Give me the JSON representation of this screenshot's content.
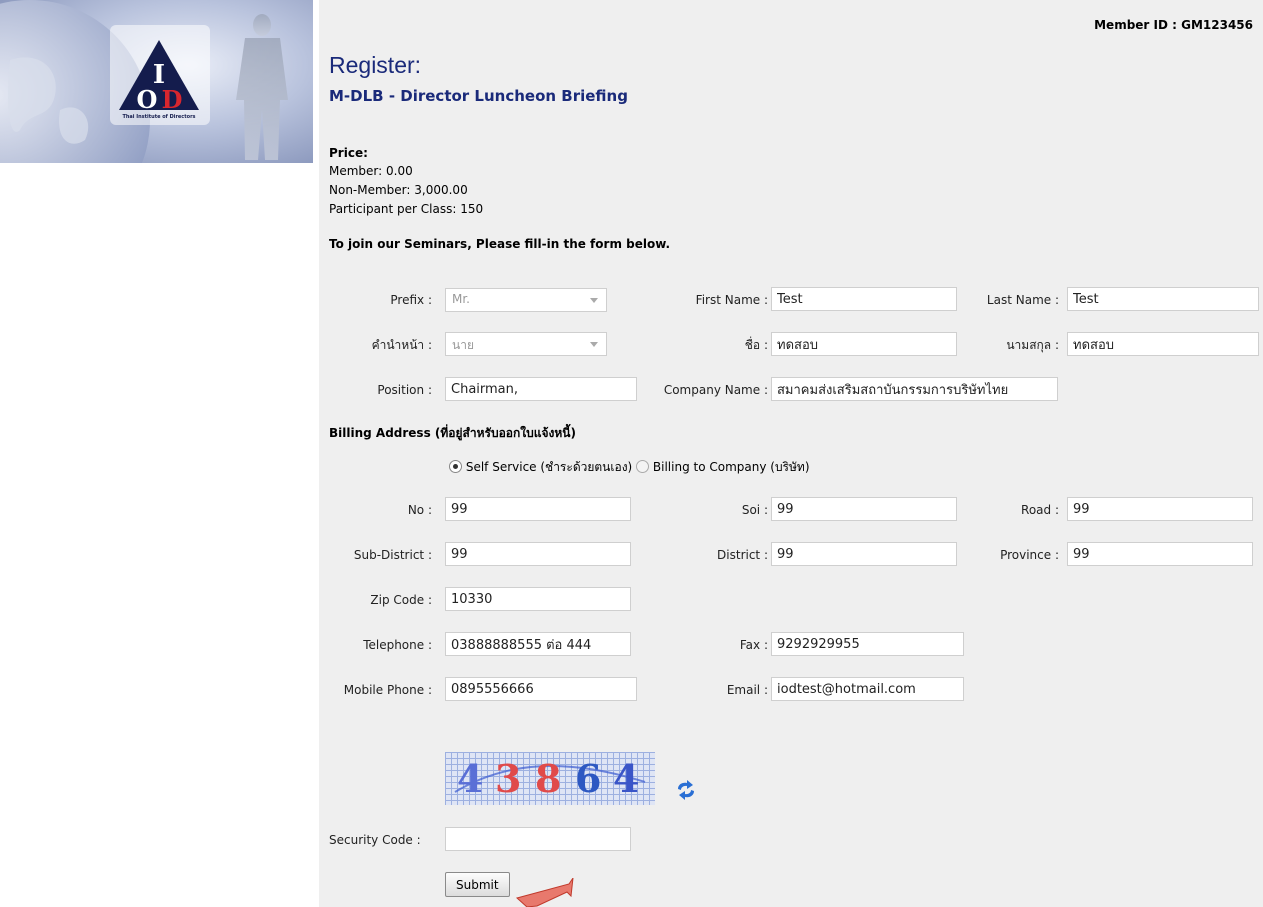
{
  "logo": {
    "letters": "IOD",
    "tagline": "Thai Institute of Directors"
  },
  "member_id": "Member ID : GM123456",
  "header": {
    "title": "Register:",
    "subtitle": "M-DLB - Director Luncheon Briefing"
  },
  "price": {
    "heading": "Price:",
    "member": "Member: 0.00",
    "non_member": "Non-Member: 3,000.00",
    "participants": "Participant per Class: 150"
  },
  "instructions": "To join our Seminars, Please fill-in the form below.",
  "form": {
    "prefix": {
      "label": "Prefix :",
      "value": "Mr."
    },
    "first_name": {
      "label": "First Name :",
      "value": "Test"
    },
    "last_name": {
      "label": "Last Name :",
      "value": "Test"
    },
    "prefix_th": {
      "label": "คำนำหน้า :",
      "value": "นาย"
    },
    "first_name_th": {
      "label": "ชื่อ :",
      "value": "ทดสอบ"
    },
    "last_name_th": {
      "label": "นามสกุล :",
      "value": "ทดสอบ"
    },
    "position": {
      "label": "Position :",
      "value": "Chairman,"
    },
    "company": {
      "label": "Company Name :",
      "value": "สมาคมส่งเสริมสถาบันกรรมการบริษัทไทย"
    }
  },
  "billing": {
    "heading": "Billing Address (ที่อยู่สำหรับออกใบแจ้งหนี้)",
    "option_self": "Self Service (ชำระด้วยตนเอง)",
    "option_company": "Billing to Company (บริษัท)",
    "no": {
      "label": "No :",
      "value": "99"
    },
    "soi": {
      "label": "Soi :",
      "value": "99"
    },
    "road": {
      "label": "Road :",
      "value": "99"
    },
    "sub_district": {
      "label": "Sub-District :",
      "value": "99"
    },
    "district": {
      "label": "District :",
      "value": "99"
    },
    "province": {
      "label": "Province :",
      "value": "99"
    },
    "zip": {
      "label": "Zip Code :",
      "value": "10330"
    },
    "telephone": {
      "label": "Telephone :",
      "value": "03888888555 ต่อ 444"
    },
    "fax": {
      "label": "Fax :",
      "value": "9292929955"
    },
    "mobile": {
      "label": "Mobile Phone :",
      "value": "0895556666"
    },
    "email": {
      "label": "Email :",
      "value": "iodtest@hotmail.com"
    }
  },
  "captcha": {
    "digits": [
      "4",
      "3",
      "8",
      "6",
      "4"
    ],
    "refresh_icon": "refresh-icon"
  },
  "security": {
    "label": "Security Code :",
    "value": ""
  },
  "submit_label": "Submit",
  "colors": {
    "title_blue": "#1a2a7a",
    "panel_bg": "#efefef",
    "logo_red": "#d8262e"
  }
}
